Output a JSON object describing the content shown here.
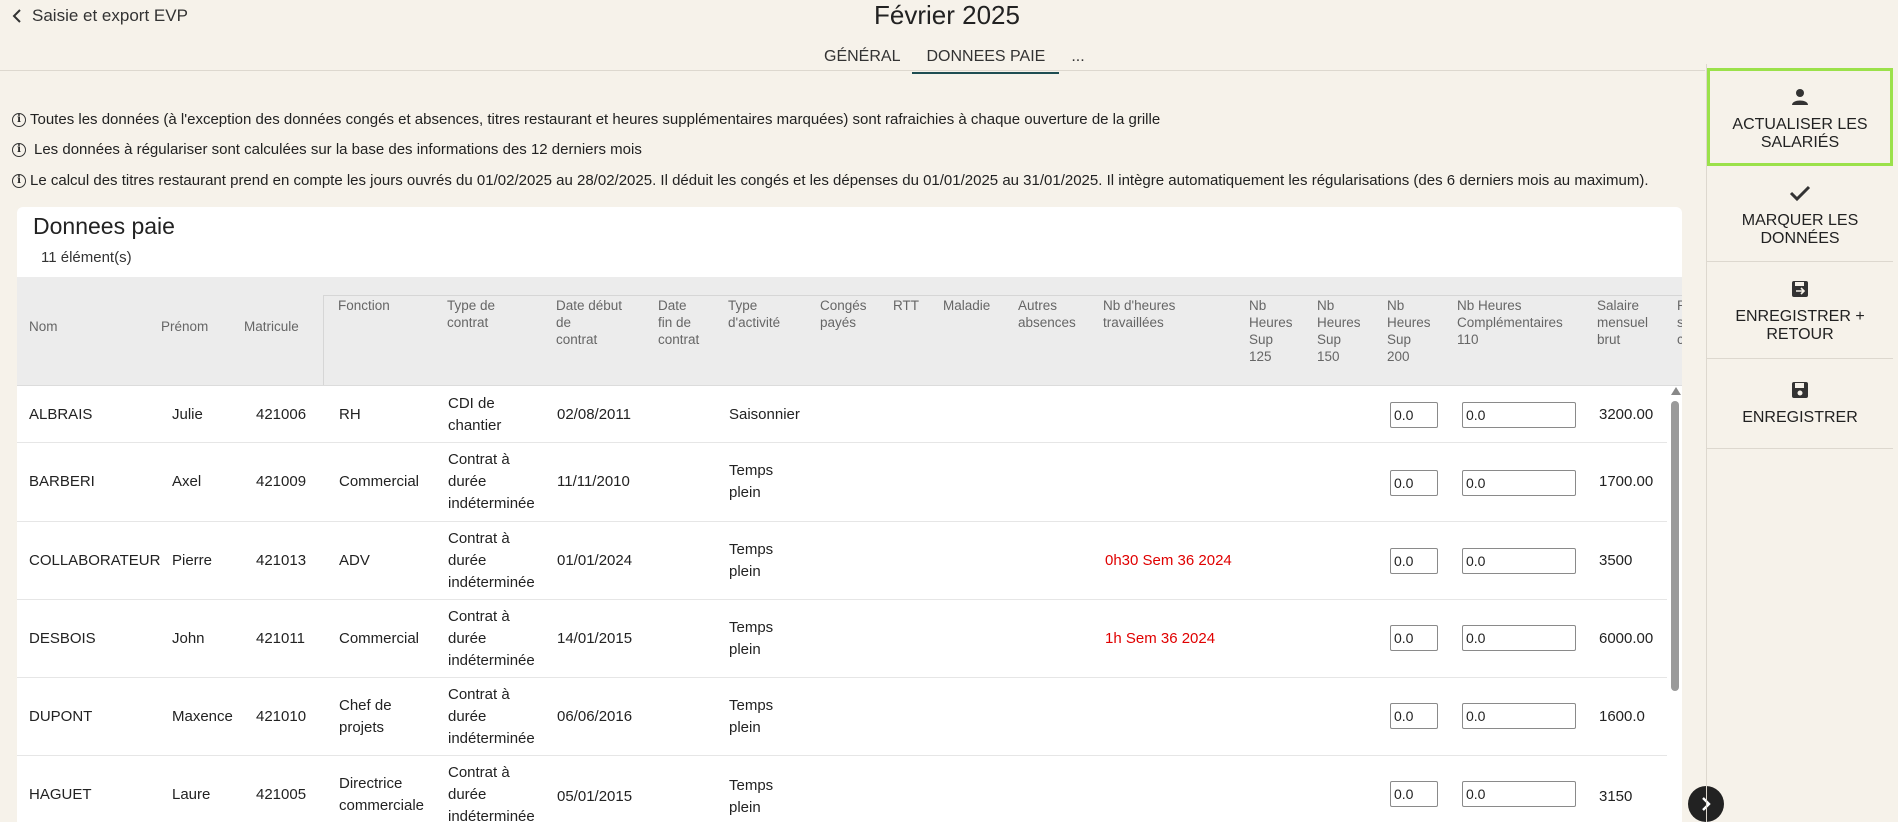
{
  "header": {
    "back_label": "Saisie et export EVP",
    "title": "Février 2025",
    "tabs": [
      {
        "label": "GÉNÉRAL",
        "active": false
      },
      {
        "label": "DONNEES PAIE",
        "active": true
      },
      {
        "label": "...",
        "active": false
      }
    ]
  },
  "info_lines": [
    "Toutes les données (à l'exception des données congés et absences, titres restaurant et heures supplémentaires marquées) sont rafraichies à chaque ouverture de la grille",
    "Les données à régulariser sont calculées sur la base des informations des 12 derniers mois",
    "Le calcul des titres restaurant prend en compte les jours ouvrés du 01/02/2025 au 28/02/2025. Il déduit les congés et les dépenses du 01/01/2025 au 31/01/2025. Il intègre automatiquement les régularisations (des 6 derniers mois au maximum)."
  ],
  "table": {
    "title": "Donnees paie",
    "count": "11 élément(s)",
    "columns": {
      "nom": "Nom",
      "prenom": "Prénom",
      "matricule": "Matricule",
      "fonction": "Fonction",
      "type_contrat": [
        "Type de",
        "contrat"
      ],
      "date_debut": [
        "Date début",
        "de",
        "contrat"
      ],
      "date_fin": [
        "Date",
        "fin de",
        "contrat"
      ],
      "type_activite": [
        "Type",
        "d'activité"
      ],
      "conges": [
        "Congés",
        "payés"
      ],
      "rtt": "RTT",
      "maladie": "Maladie",
      "autres": [
        "Autres",
        "absences"
      ],
      "heures_trav": [
        "Nb d'heures",
        "travaillées"
      ],
      "sup125": [
        "Nb",
        "Heures",
        "Sup",
        "125"
      ],
      "sup150": [
        "Nb",
        "Heures",
        "Sup",
        "150"
      ],
      "sup200": [
        "Nb",
        "Heures",
        "Sup",
        "200"
      ],
      "comp110": [
        "Nb Heures",
        "Complémentaires",
        "110"
      ],
      "salaire": [
        "Salaire",
        "mensuel",
        "brut"
      ],
      "cut": [
        "P",
        "s",
        "c"
      ]
    },
    "rows": [
      {
        "nom": "ALBRAIS",
        "prenom": "Julie",
        "matricule": "421006",
        "fonction": [
          "RH"
        ],
        "contrat": [
          "CDI de",
          "chantier"
        ],
        "debut": "02/08/2011",
        "activite": [
          "Saisonnier"
        ],
        "heures": "",
        "sup200": "0.0",
        "comp110": "0.0",
        "salaire": "3200.00"
      },
      {
        "nom": "BARBERI",
        "prenom": "Axel",
        "matricule": "421009",
        "fonction": [
          "Commercial"
        ],
        "contrat": [
          "Contrat à",
          "durée",
          "indéterminée"
        ],
        "debut": "11/11/2010",
        "activite": [
          "Temps",
          "plein"
        ],
        "heures": "",
        "sup200": "0.0",
        "comp110": "0.0",
        "salaire": "1700.00"
      },
      {
        "nom": "COLLABORATEUR",
        "prenom": "Pierre",
        "matricule": "421013",
        "fonction": [
          "ADV"
        ],
        "contrat": [
          "Contrat à",
          "durée",
          "indéterminée"
        ],
        "debut": "01/01/2024",
        "activite": [
          "Temps",
          "plein"
        ],
        "heures": "0h30 Sem 36 2024",
        "sup200": "0.0",
        "comp110": "0.0",
        "salaire": "3500"
      },
      {
        "nom": "DESBOIS",
        "prenom": "John",
        "matricule": "421011",
        "fonction": [
          "Commercial"
        ],
        "contrat": [
          "Contrat à",
          "durée",
          "indéterminée"
        ],
        "debut": "14/01/2015",
        "activite": [
          "Temps",
          "plein"
        ],
        "heures": "1h Sem 36 2024",
        "sup200": "0.0",
        "comp110": "0.0",
        "salaire": "6000.00"
      },
      {
        "nom": "DUPONT",
        "prenom": "Maxence",
        "matricule": "421010",
        "fonction": [
          "Chef de",
          "projets"
        ],
        "contrat": [
          "Contrat à",
          "durée",
          "indéterminée"
        ],
        "debut": "06/06/2016",
        "activite": [
          "Temps",
          "plein"
        ],
        "heures": "",
        "sup200": "0.0",
        "comp110": "0.0",
        "salaire": "1600.0"
      },
      {
        "nom": "HAGUET",
        "prenom": "Laure",
        "matricule": "421005",
        "fonction": [
          "Directrice",
          "commerciale"
        ],
        "contrat": [
          "Contrat à",
          "durée",
          "indéterminée"
        ],
        "debut": "05/01/2015",
        "activite": [
          "Temps",
          "plein"
        ],
        "heures": "",
        "sup200": "0.0",
        "comp110": "0.0",
        "salaire": "3150"
      }
    ]
  },
  "side_panel": {
    "buttons": [
      {
        "label": "ACTUALISER LES SALARIÉS",
        "icon": "person-icon",
        "focused": true
      },
      {
        "label": "MARQUER LES DONNÉES",
        "icon": "check-icon",
        "focused": false
      },
      {
        "label": "ENREGISTRER + RETOUR",
        "icon": "save-return-icon",
        "focused": false
      },
      {
        "label": "ENREGISTRER",
        "icon": "save-icon",
        "focused": false
      }
    ]
  },
  "colors": {
    "accent": "#1e4d52",
    "focus_outline": "#9be14a",
    "warning_text": "#e00000",
    "background": "#f6f2ea"
  }
}
